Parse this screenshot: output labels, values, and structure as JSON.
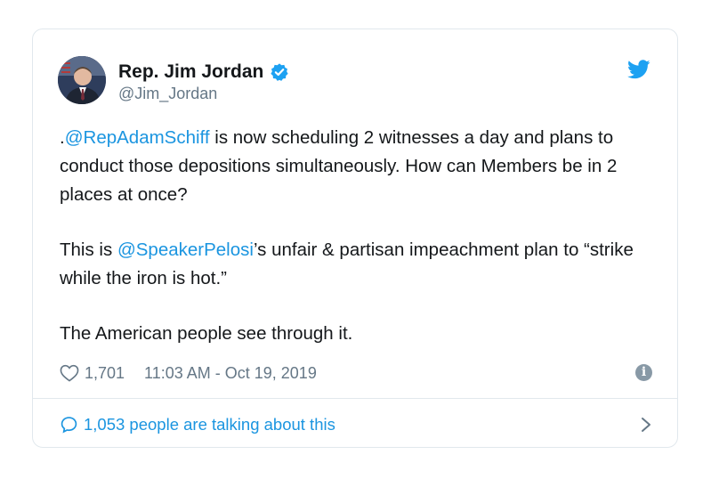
{
  "tweet": {
    "display_name": "Rep. Jim Jordan",
    "handle": "@Jim_Jordan",
    "paragraph1_prefix": ".",
    "mention1": "@RepAdamSchiff",
    "paragraph1_rest": " is now scheduling 2 witnesses a day and plans to conduct those depositions simultaneously. How can Members be in 2 places at once?",
    "paragraph2_prefix": "This is ",
    "mention2": "@SpeakerPelosi",
    "paragraph2_rest": "’s unfair & partisan impeachment plan to “strike while the iron is hot.”",
    "paragraph3": "The American people see through it.",
    "likes": "1,701",
    "timestamp": "11:03 AM - Oct 19, 2019",
    "talking": "1,053 people are talking about this"
  },
  "icons": {
    "verified": "verified-badge-icon",
    "bird": "twitter-bird-icon",
    "heart": "heart-icon",
    "info": "info-icon",
    "bubble": "speech-bubble-icon",
    "chevron": "chevron-right-icon"
  },
  "colors": {
    "link": "#1b95e0",
    "muted": "#657786",
    "text": "#14171a",
    "border": "#e1e8ed"
  }
}
